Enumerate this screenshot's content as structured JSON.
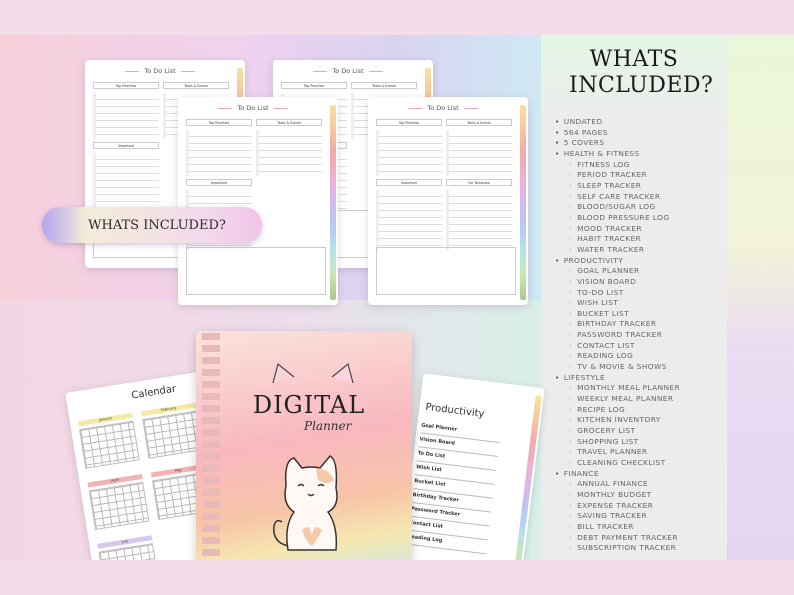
{
  "panel": {
    "title": "WHATS INCLUDED?",
    "items": [
      {
        "t": "UNDATED",
        "lvl": 0
      },
      {
        "t": "564 PAGES",
        "lvl": 0
      },
      {
        "t": "5 COVERS",
        "lvl": 0
      },
      {
        "t": "HEALTH & FITNESS",
        "lvl": 0
      },
      {
        "t": "FITNESS LOG",
        "lvl": 1
      },
      {
        "t": "PERIOD TRACKER",
        "lvl": 1
      },
      {
        "t": "SLEEP TRACKER",
        "lvl": 1
      },
      {
        "t": "SELF CARE TRACKER",
        "lvl": 1
      },
      {
        "t": "BLOOD/SUGAR LOG",
        "lvl": 1
      },
      {
        "t": "BLOOD PRESSURE LOG",
        "lvl": 1
      },
      {
        "t": "MOOD TRACKER",
        "lvl": 1
      },
      {
        "t": "HABIT TRACKER",
        "lvl": 1
      },
      {
        "t": "WATER TRACKER",
        "lvl": 1
      },
      {
        "t": "PRODUCTIVITY",
        "lvl": 0
      },
      {
        "t": "GOAL PLANNER",
        "lvl": 1
      },
      {
        "t": "VISION BOARD",
        "lvl": 1
      },
      {
        "t": "TO-DO LIST",
        "lvl": 1
      },
      {
        "t": "WISH LIST",
        "lvl": 1
      },
      {
        "t": "BUCKET LIST",
        "lvl": 1
      },
      {
        "t": "BIRTHDAY TRACKER",
        "lvl": 1
      },
      {
        "t": "PASSWORD TRACKER",
        "lvl": 1
      },
      {
        "t": "CONTACT LIST",
        "lvl": 1
      },
      {
        "t": "READING LOG",
        "lvl": 1
      },
      {
        "t": "TV & MOVIE & SHOWS",
        "lvl": 1
      },
      {
        "t": "LIFESTYLE",
        "lvl": 0
      },
      {
        "t": "MONTHLY MEAL PLANNER",
        "lvl": 1
      },
      {
        "t": "WEEKLY MEAL PLANNER",
        "lvl": 1
      },
      {
        "t": "RECIPE LOG",
        "lvl": 1
      },
      {
        "t": "KITCHEN INVENTORY",
        "lvl": 1
      },
      {
        "t": "GROCERY LIST",
        "lvl": 1
      },
      {
        "t": "SHOPPING LIST",
        "lvl": 1
      },
      {
        "t": "TRAVEL PLANNER",
        "lvl": 1
      },
      {
        "t": "CLEANING CHECKLIST",
        "lvl": 1
      },
      {
        "t": "FINANCE",
        "lvl": 0
      },
      {
        "t": "ANNUAL FINANCE",
        "lvl": 1
      },
      {
        "t": "MONTHLY BUDGET",
        "lvl": 1
      },
      {
        "t": "EXPENSE TRACKER",
        "lvl": 1
      },
      {
        "t": "SAVING TRACKER",
        "lvl": 1
      },
      {
        "t": "BILL TRACKER",
        "lvl": 1
      },
      {
        "t": "DEBT PAYMENT TRACKER",
        "lvl": 1
      },
      {
        "t": "SUBSCRIPTION TRACKER",
        "lvl": 1
      }
    ]
  },
  "pill": {
    "label": "WHATS INCLUDED?"
  },
  "todo": {
    "title": "To Do List",
    "sections": [
      "Top Priorities",
      "Tasks & Events",
      "Important",
      "For Tomorrow"
    ]
  },
  "calendar": {
    "title": "Calendar",
    "months": [
      "January",
      "February",
      "April",
      "May",
      "July"
    ]
  },
  "cover": {
    "title": "DIGITAL",
    "subtitle": "Planner"
  },
  "productivity": {
    "title": "Productivity",
    "items": [
      "Goal Planner",
      "Vision Board",
      "To Do List",
      "Wish List",
      "Bucket List",
      "Birthday Tracker",
      "Password Tracker",
      "Contact List",
      "Reading Log"
    ]
  }
}
